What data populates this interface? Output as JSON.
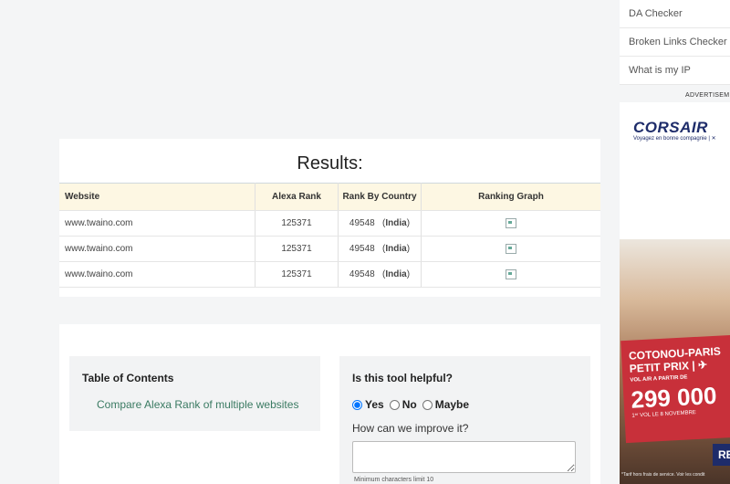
{
  "results": {
    "title": "Results:",
    "headers": [
      "Website",
      "Alexa Rank",
      "Rank By Country",
      "Ranking Graph"
    ],
    "rows": [
      {
        "website": "www.twaino.com",
        "rank": "125371",
        "country_rank": "49548",
        "country": "India"
      },
      {
        "website": "www.twaino.com",
        "rank": "125371",
        "country_rank": "49548",
        "country": "India"
      },
      {
        "website": "www.twaino.com",
        "rank": "125371",
        "country_rank": "49548",
        "country": "India"
      }
    ],
    "graph_icon": "broken-image-icon"
  },
  "toc": {
    "title": "Table of Contents",
    "link": "Compare Alexa Rank of multiple websites"
  },
  "feedback": {
    "title": "Is this tool helpful?",
    "options": [
      "Yes",
      "No",
      "Maybe"
    ],
    "selected": "Yes",
    "prompt": "How can we improve it?",
    "min_chars": "Minimum characters limit 10"
  },
  "sidebar": {
    "items": [
      "DA Checker",
      "Broken Links Checker",
      "What is my IP"
    ],
    "advertisement_label": "ADVERTISEM"
  },
  "ad": {
    "logo": "CORSAIR",
    "tagline": "Voyagez en bonne compagnie | ✕",
    "line1": "COTONOU-PARIS",
    "line2": "PETIT PRIX | ✈",
    "line3": "VOL A/R A PARTIR DE",
    "price": "299 000",
    "line4": "1ᵉʳ VOL LE 8 NOVEMBRE",
    "button": "RE",
    "footnote": "*Tarif hors frais de service. Voir les condit"
  },
  "colors": {
    "header_bg": "#fdf7e3",
    "link": "#3a7a62",
    "ad_brand": "#1e2c6a",
    "ad_banner": "#c8303a"
  }
}
